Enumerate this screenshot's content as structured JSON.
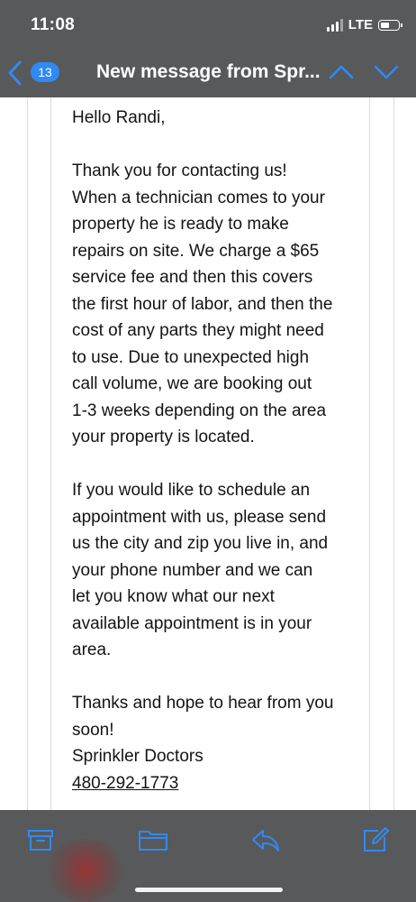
{
  "status_bar": {
    "time": "11:08",
    "network": "LTE"
  },
  "nav": {
    "unread_count": "13",
    "title": "New message from Spr...",
    "icons": [
      "chevron-left-icon",
      "chevron-up-icon",
      "chevron-down-icon"
    ],
    "badge_color": "#2f8af5",
    "bar_color": "#58595b"
  },
  "message": {
    "greeting": "Hello Randi,",
    "paragraph_1_lines": [
      "Thank you for contacting us!",
      "When a technician comes to your",
      "property he is ready to make",
      "repairs on site. We charge a $65",
      "service fee and then this covers",
      "the first hour of labor, and then the",
      "cost of any parts they might need",
      "to use. Due to unexpected high",
      "call volume, we are booking out",
      "1-3 weeks depending on the area",
      "your property is located."
    ],
    "paragraph_2_lines": [
      "If you would like to schedule an",
      "appointment with us, please send",
      "us the city and zip you live in, and",
      "your phone number and we can",
      "let you know what our next",
      "available appointment is in your",
      "area."
    ],
    "closing_lines": [
      "Thanks and hope to hear from you",
      "soon!"
    ],
    "signature": "Sprinkler Doctors",
    "phone": "480-292-1773"
  },
  "toolbar": {
    "icons": [
      "archive-icon",
      "folder-icon",
      "reply-icon",
      "compose-icon"
    ],
    "icon_color": "#2f8af5"
  }
}
